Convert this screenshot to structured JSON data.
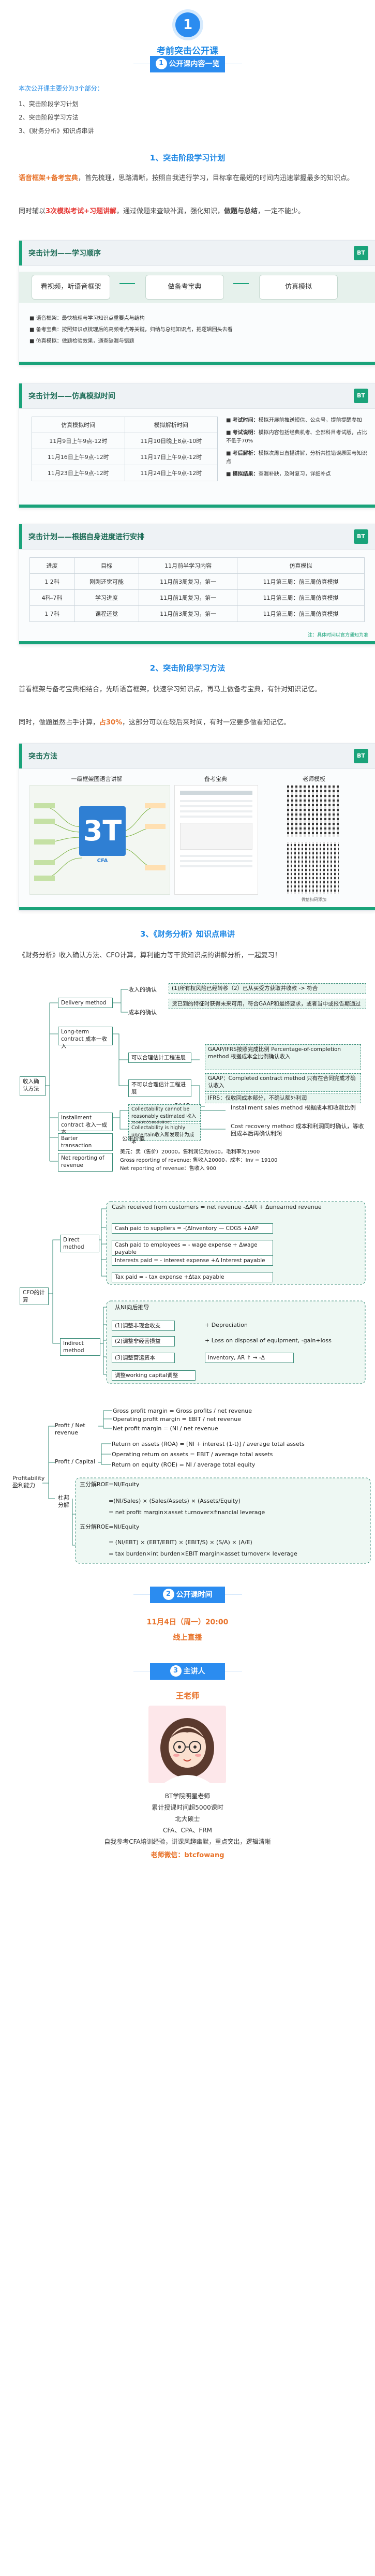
{
  "header": {
    "badge": "1",
    "title": "考前突击公开课"
  },
  "pill1": {
    "num": "1",
    "label": "公开课内容一览"
  },
  "intro": {
    "lead": "本次公开课主要分为3个部分：",
    "items": [
      "1、突击阶段学习计划",
      "2、突击阶段学习方法",
      "3、《财务分析》知识点串讲"
    ]
  },
  "sec1": {
    "title": "1、突击阶段学习计划",
    "p1_a": "语音框架+备考宝典",
    "p1_b": "，首先梳理，思路清晰，按照自我进行学习，目标拿在最短的时间内迅速掌握最多的知识点。",
    "p2_a": "同时辅以",
    "p2_b": "3次模拟考试+习题讲解",
    "p2_c": "，通过做题来查缺补漏，强化知识，",
    "p2_d": "做题与总结",
    "p2_e": "，一定不能少。"
  },
  "slide1": {
    "title": "突击计划——学习顺序",
    "logo": "BT",
    "steps": [
      "看视频，听语音框架",
      "做备考宝典",
      "仿真模拟"
    ],
    "bullets": [
      "语音框架：最快梳理与学习知识点重要点与结构",
      "备考宝典：按照知识点梳理后的高频考点等关键，归纳与总结知识点，把逻辑回头去看",
      "仿真模拟：做题检验效果，通查缺漏与错题"
    ]
  },
  "slide2": {
    "title": "突击计划——仿真模拟时间",
    "logo": "BT",
    "headers": [
      "仿真模拟时间",
      "模拟解析时间"
    ],
    "rows": [
      [
        "11月9日上午9点-12时",
        "11月10日晚上8点-10时"
      ],
      [
        "11月16日上午9点-12时",
        "11月17日上午9点-12时"
      ],
      [
        "11月23日上午9点-12时",
        "11月24日上午9点-12时"
      ]
    ],
    "notes": [
      {
        "k": "考试时间：",
        "v": "模拟开展前推送短信、公众号，提前提醒参加"
      },
      {
        "k": "考试说明：",
        "v": "模拟内容包括经典机考、全部科目考试版，占比不低于70%"
      },
      {
        "k": "考后解析：",
        "v": "模拟次周日直播讲解，分析共性错误原因与知识点"
      },
      {
        "k": "模拟结果：",
        "v": "查漏补缺，及时复习，详细补点"
      }
    ]
  },
  "slide3": {
    "title": "突击计划——根据自身进度进行安排",
    "logo": "BT",
    "headers": [
      "进度",
      "目标",
      "11月前半学习内容",
      "仿真模拟"
    ],
    "rows": [
      [
        "1 2科",
        "刚刚还觉可能",
        "11月前3周复习，第一",
        "11月第三周：前三周仿真模拟"
      ],
      [
        "4科-7科",
        "学习进度",
        "11月前1周复习，第一",
        "11月第三周：前三周仿真模拟"
      ],
      [
        "1 7科",
        "课程还觉",
        "11月前3周复习，第一",
        "11月第三周：前三周仿真模拟"
      ]
    ],
    "footnote": "注：具体时间以官方通知为准"
  },
  "sec2": {
    "title": "2、突击阶段学习方法",
    "p1": "首看框架与备考宝典相结合，先听语音框架，快速学习知识点，再马上做备考宝典，有针对知识记忆。",
    "p2_a": "同时，做题虽然占手计算，",
    "p2_b": "占30%",
    "p2_c": "，这部分可以在较后来时间，有时一定要多做看知记忆。"
  },
  "slide4": {
    "title": "突击方法",
    "logo": "BT",
    "col_titles": [
      "一级框架图语言讲解",
      "备考宝典",
      "老师模板"
    ],
    "logo_text": "3T",
    "logo_sub": "CFA",
    "qr_caption": "微信扫码添加"
  },
  "sec3": {
    "title": "3、《财务分析》知识点串讲",
    "p1": "《财务分析》收入确认方法、CFO计算，算利能力等干货知识点的讲解分析，一起复习！"
  },
  "diagram1": {
    "root": "收入确认方法",
    "delivery": "Delivery method",
    "longterm": "Long-term contract 成本一收入",
    "installment": "Installment contract 收入一成本",
    "barter": "Barter transaction",
    "barter_note": "公平价值",
    "netrev": "Net reporting of revenue",
    "cond1": "(1)所有权风险已经转移（2）已从买受方获取并收款 -> 符合",
    "cond2": "收入的确认",
    "cond3": "货已到的特征时获得未来可用，符合GAAP和最终要求，或者当中或报告期通过",
    "cond4": "成本的确认",
    "pct": "可以合理估计工程进展",
    "pct_r": "GAAP/IFRS按照完成比例 Percentage-of-completion method 根据成本全比例确认收入",
    "comp": "不可以合理估计工程进展",
    "comp_r1": "GAAP：Completed contract method 只有在合同完成才确认收入",
    "comp_r2": "IFRS：仅收回成本部分，不确认额外利润",
    "gaap": "GAAP",
    "inst1": "Collectability cannot be reasonably estimated 收入及所有的现金收取",
    "inst1_r": "Installment sales method 根据成本和收款比例",
    "inst2": "Collectability is highly uncertain收入和发现计为成本",
    "inst2_r": "Cost recovery method 成本和利润同时确认，等收回成本后再确认利润",
    "net1": "美元：卖（售价）20000，售利润记为(600，毛利率为1900",
    "net2": "Gross reporting of revenue: 售收入20000，成本：Inv = 19100",
    "net3": "Net reporting of revenue：售收入 900"
  },
  "diagram2": {
    "root": "CFO的计算",
    "direct": "Direct method",
    "indirect": "Indirect method",
    "d1": "Cash received from customers = net revenue -ΔAR + Δunearned revenue",
    "d2": "Cash paid to suppliers = -(ΔInventory — COGS +ΔAP",
    "d3": "Cash paid to employees = - wage expense + Δwage payable",
    "d4": "Interests paid = - interest expense +Δ Interest payable",
    "d5": "Tax paid = - tax expense +Δtax payable",
    "i0": "从NI向后推导",
    "i1": "(1)调整非现金收支",
    "i1r": "+ Depreciation",
    "i2": "(2)调整非经营损益",
    "i2r": "+ Loss on disposal of equipment, -gain+loss",
    "i3": "(3)调整营运资本",
    "i3r": "Inventory, AR ↑ → -Δ",
    "i4": "调整working capital调整"
  },
  "diagram3": {
    "root": "Profitability 盈利能力",
    "pnr": "Profit / Net revenue",
    "pc": "Profit / Capital",
    "dupont": "杜邦分解",
    "gpm": "Gross profit margin = Gross profits / net revenue",
    "opm": "Operating profit margin = EBIT / net revenue",
    "npm": "Net profit margin = (NI / net revenue",
    "roa": "Return on assets (ROA) = [NI + interest (1-t)] / average total assets",
    "oroa": "Operating return on assets = EBIT / average total assets",
    "roe": "Return on equity (ROE) = NI / average total equity",
    "three": "三分解ROE=NI/Equity",
    "three_a": "=(NI/Sales) × (Sales/Assets) × (Assets/Equity)",
    "three_b": "= net profit margin×asset turnover×financial leverage",
    "five": "五分解ROE=NI/Equity",
    "five_a": "= (NI/EBT) × (EBT/EBIT) × (EBIT/S) × (S/A) × (A/E)",
    "five_b": "= tax burden×int burden×EBIT margin×asset turnover× leverage"
  },
  "pill2": {
    "num": "2",
    "label": "公开课时间"
  },
  "time": {
    "line1": "11月4日（周一）20:00",
    "line2": "线上直播"
  },
  "pill3": {
    "num": "3",
    "label": "主讲人"
  },
  "teacher": {
    "name": "王老师",
    "lines": [
      "BT学院明星老师",
      "累计授课时间超5000课时",
      "北大硕士",
      "CFA、CPA、FRM",
      "自我参考CFA培训经验，讲课风趣幽默，重点突出，逻辑清晰"
    ],
    "wechat_label": "老师微信：",
    "wechat": "btcfowang"
  },
  "colors": {
    "accent": "#2b8cf0",
    "green": "#1aa37a",
    "orange": "#e8742c",
    "red": "#e53935"
  }
}
